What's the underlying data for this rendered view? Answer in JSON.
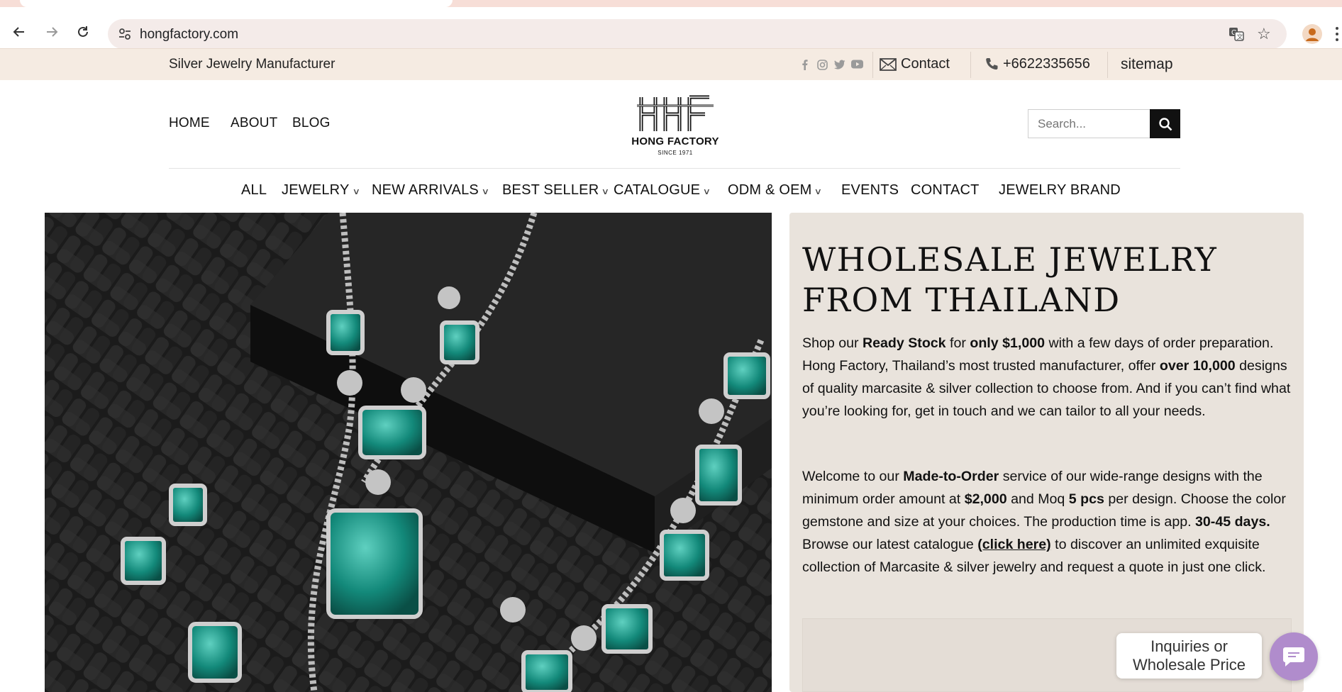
{
  "browser": {
    "url": "hongfactory.com"
  },
  "topbar": {
    "tagline": "Silver Jewelry Manufacturer",
    "social_icons": [
      "facebook-icon",
      "instagram-icon",
      "twitter-icon",
      "youtube-icon"
    ],
    "contact_label": "Contact",
    "phone": "+6622335656",
    "sitemap_label": "sitemap"
  },
  "header": {
    "nav": [
      "HOME",
      "ABOUT",
      "BLOG"
    ],
    "logo_name": "HONG FACTORY",
    "logo_since": "SINCE 1971",
    "search_placeholder": "Search..."
  },
  "catnav": [
    {
      "label": "ALL",
      "dropdown": false
    },
    {
      "label": "JEWELRY",
      "dropdown": true
    },
    {
      "label": "NEW ARRIVALS",
      "dropdown": true
    },
    {
      "label": "BEST SELLER",
      "dropdown": true
    },
    {
      "label": "CATALOGUE",
      "dropdown": true
    },
    {
      "label": "ODM & OEM",
      "dropdown": true
    },
    {
      "label": "EVENTS",
      "dropdown": false
    },
    {
      "label": "CONTACT",
      "dropdown": false
    },
    {
      "label": "JEWELRY BRAND",
      "dropdown": false
    }
  ],
  "hero": {
    "title_line1": "WHOLESALE JEWELRY",
    "title_line2": "FROM THAILAND",
    "p1": {
      "t1": "Shop our ",
      "b1": "Ready Stock",
      "t2": " for ",
      "b2": "only $1,000",
      "t3": " with a few days of order preparation. Hong Factory, Thailand’s most trusted manufacturer, offer ",
      "b3": "over 10,000",
      "t4": " designs of quality marcasite & silver collection to choose from. And if you can’t find what you’re looking for, get in touch and we can tailor to all your needs."
    },
    "p2": {
      "t1": "Welcome to our ",
      "b1": "Made-to-Order",
      "t2": " service of our wide-range designs with the minimum order amount at ",
      "b2": "$2,000",
      "t3": " and Moq ",
      "b3": "5 pcs",
      "t4": " per design. Choose the color gemstone and size at your choices. The production time is app. ",
      "b4": "30-45 days.",
      "t5": " Browse our latest catalogue ",
      "link": "(click here)",
      "t6": " to discover an unlimited exquisite collection of Marcasite & silver jewelry and request a quote in just one click."
    }
  },
  "chat": {
    "line1": "Inquiries or",
    "line2": "Wholesale Price"
  },
  "colors": {
    "topbar_bg": "#f5ebe2",
    "panel_bg": "#e9e3dc",
    "chat_accent": "#b08ccc",
    "gem": "#1a9c8a"
  }
}
